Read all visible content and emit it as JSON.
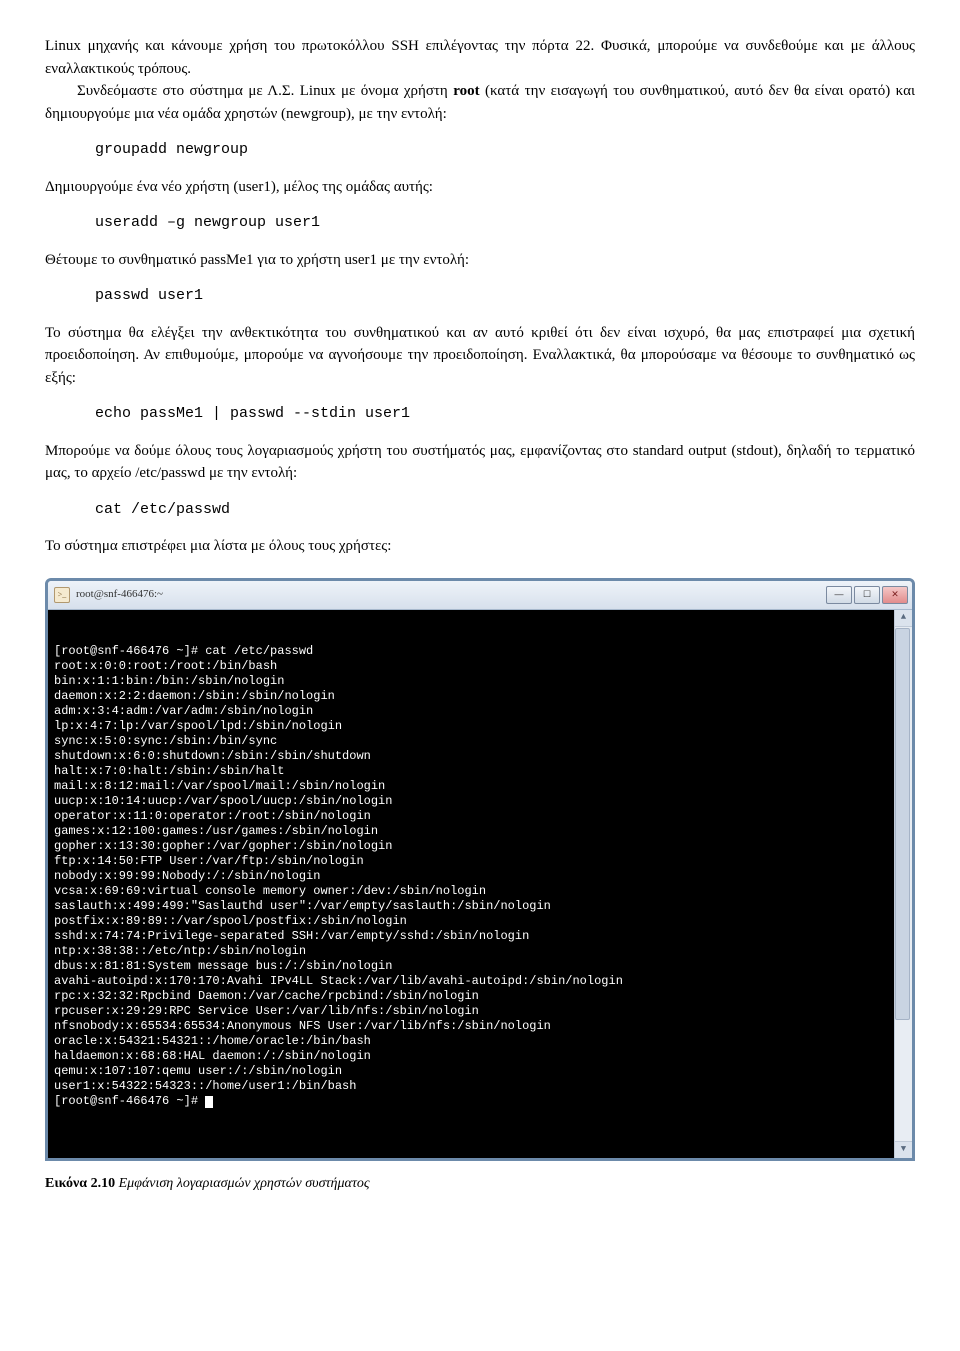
{
  "para1_a": "Linux μηχανής και κάνουμε χρήση του πρωτοκόλλου SSH επιλέγοντας την πόρτα 22. Φυσικά, μπορούμε να συνδεθούμε και με άλλους εναλλακτικούς τρόπους.",
  "para1_b_pre": "Συνδεόμαστε στο σύστημα με Λ.Σ. Linux με όνομα χρήστη ",
  "para1_b_root": "root",
  "para1_b_post": " (κατά την εισαγωγή του συνθηματικού, αυτό δεν θα είναι ορατό) και δημιουργούμε μια νέα ομάδα χρηστών (newgroup), με την εντολή:",
  "cmd1": "groupadd newgroup",
  "para2": "Δημιουργούμε ένα νέο χρήστη (user1), μέλος της ομάδας αυτής:",
  "cmd2": "useradd –g newgroup user1",
  "para3": "Θέτουμε το συνθηματικό passMe1 για το χρήστη user1 με την εντολή:",
  "cmd3": "passwd user1",
  "para4": "Το σύστημα θα ελέγξει την ανθεκτικότητα του συνθηματικού και αν αυτό κριθεί ότι δεν είναι ισχυρό, θα μας επιστραφεί μια σχετική προειδοποίηση. Αν επιθυμούμε, μπορούμε να αγνοήσουμε την προειδοποίηση. Εναλλακτικά, θα μπορούσαμε να θέσουμε το συνθηματικό ως εξής:",
  "cmd4": "echo passMe1 | passwd --stdin user1",
  "para5": "Μπορούμε να δούμε όλους τους λογαριασμούς χρήστη του συστήματός μας, εμφανίζοντας στο standard output (stdout), δηλαδή το τερματικό μας, το αρχείο /etc/passwd με την εντολή:",
  "cmd5": "cat /etc/passwd",
  "para6": "Το σύστημα επιστρέφει μια λίστα με όλους τους χρήστες:",
  "terminal": {
    "title": "root@snf-466476:~",
    "lines": [
      "[root@snf-466476 ~]# cat /etc/passwd",
      "root:x:0:0:root:/root:/bin/bash",
      "bin:x:1:1:bin:/bin:/sbin/nologin",
      "daemon:x:2:2:daemon:/sbin:/sbin/nologin",
      "adm:x:3:4:adm:/var/adm:/sbin/nologin",
      "lp:x:4:7:lp:/var/spool/lpd:/sbin/nologin",
      "sync:x:5:0:sync:/sbin:/bin/sync",
      "shutdown:x:6:0:shutdown:/sbin:/sbin/shutdown",
      "halt:x:7:0:halt:/sbin:/sbin/halt",
      "mail:x:8:12:mail:/var/spool/mail:/sbin/nologin",
      "uucp:x:10:14:uucp:/var/spool/uucp:/sbin/nologin",
      "operator:x:11:0:operator:/root:/sbin/nologin",
      "games:x:12:100:games:/usr/games:/sbin/nologin",
      "gopher:x:13:30:gopher:/var/gopher:/sbin/nologin",
      "ftp:x:14:50:FTP User:/var/ftp:/sbin/nologin",
      "nobody:x:99:99:Nobody:/:/sbin/nologin",
      "vcsa:x:69:69:virtual console memory owner:/dev:/sbin/nologin",
      "saslauth:x:499:499:\"Saslauthd user\":/var/empty/saslauth:/sbin/nologin",
      "postfix:x:89:89::/var/spool/postfix:/sbin/nologin",
      "sshd:x:74:74:Privilege-separated SSH:/var/empty/sshd:/sbin/nologin",
      "ntp:x:38:38::/etc/ntp:/sbin/nologin",
      "dbus:x:81:81:System message bus:/:/sbin/nologin",
      "avahi-autoipd:x:170:170:Avahi IPv4LL Stack:/var/lib/avahi-autoipd:/sbin/nologin",
      "rpc:x:32:32:Rpcbind Daemon:/var/cache/rpcbind:/sbin/nologin",
      "rpcuser:x:29:29:RPC Service User:/var/lib/nfs:/sbin/nologin",
      "nfsnobody:x:65534:65534:Anonymous NFS User:/var/lib/nfs:/sbin/nologin",
      "oracle:x:54321:54321::/home/oracle:/bin/bash",
      "haldaemon:x:68:68:HAL daemon:/:/sbin/nologin",
      "qemu:x:107:107:qemu user:/:/sbin/nologin",
      "user1:x:54322:54323::/home/user1:/bin/bash",
      "[root@snf-466476 ~]# "
    ]
  },
  "caption": {
    "num": "Εικόνα 2.10",
    "text": " Εμφάνιση λογαριασμών χρηστών συστήματος"
  },
  "winbtn": {
    "min": "—",
    "max": "☐",
    "close": "✕"
  }
}
